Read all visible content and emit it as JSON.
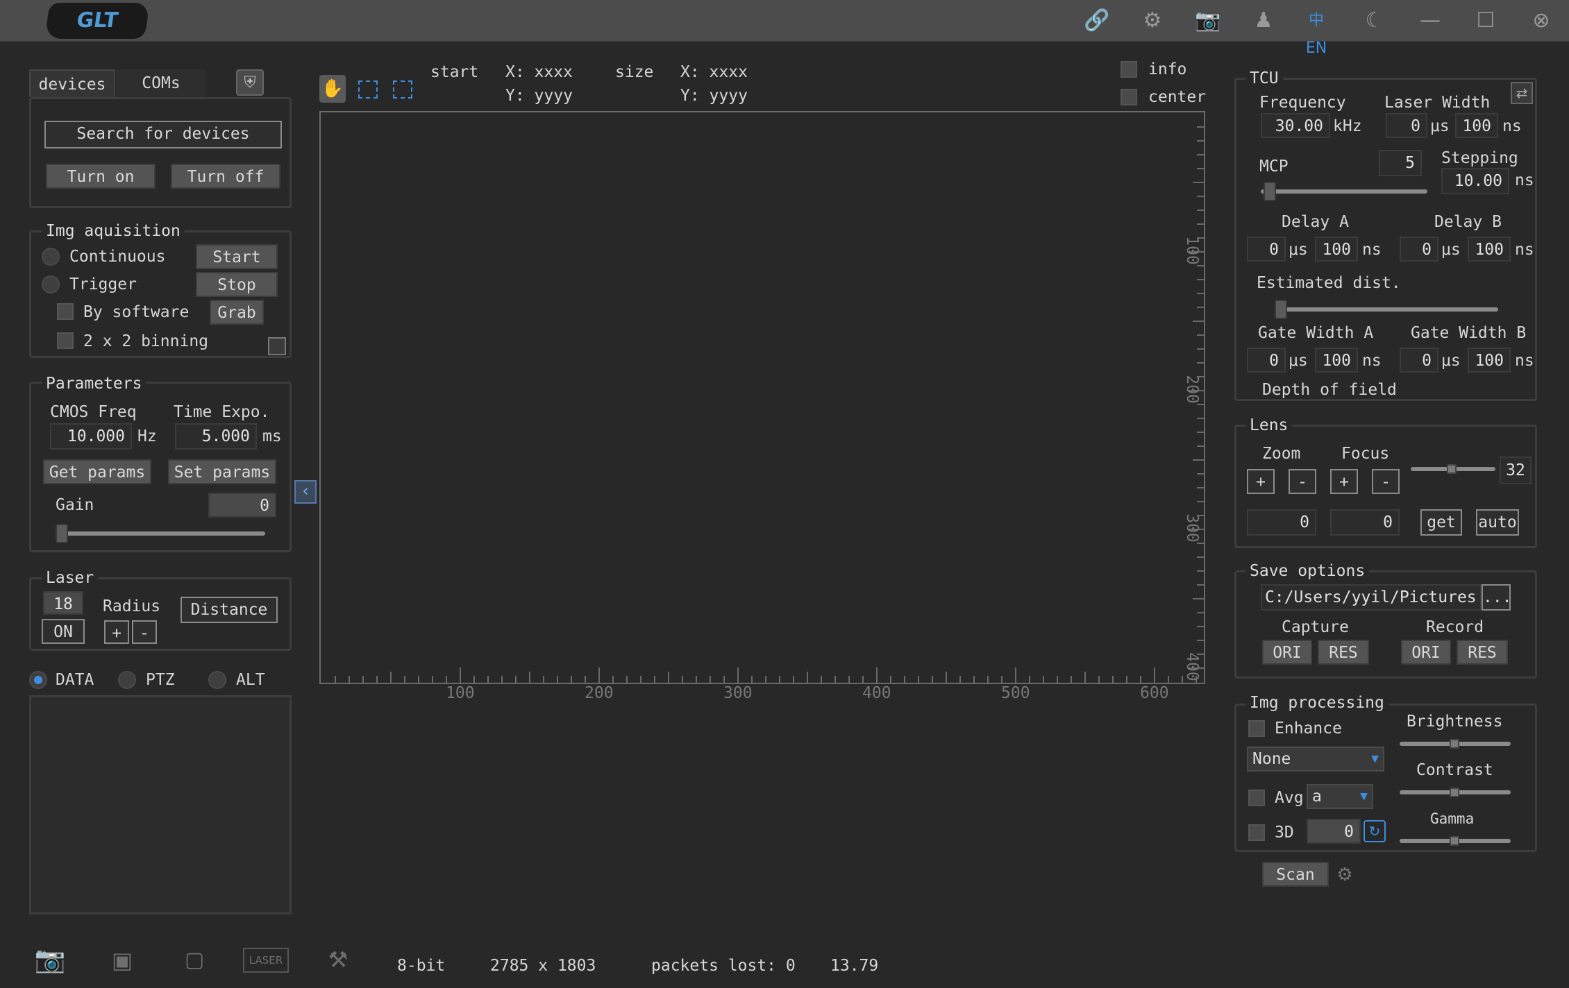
{
  "titlebar": {
    "logo_text": "GLT",
    "icons": [
      "link-icon",
      "gear-icon",
      "camera-icon",
      "user-icon",
      "language-icon",
      "moon-icon",
      "minimize-icon",
      "maximize-icon",
      "close-icon"
    ],
    "language_glyph": "中EN"
  },
  "devices_panel": {
    "tabs": [
      "devices",
      "COMs"
    ],
    "search_label": "Search for devices",
    "turn_on_label": "Turn on",
    "turn_off_label": "Turn off"
  },
  "img_acquisition": {
    "title": "Img aquisition",
    "continuous_label": "Continuous",
    "trigger_label": "Trigger",
    "by_software_label": "By software",
    "binning_label": "2 x 2 binning",
    "start_label": "Start",
    "stop_label": "Stop",
    "grab_label": "Grab"
  },
  "parameters": {
    "title": "Parameters",
    "cmos_freq_label": "CMOS Freq",
    "time_expo_label": "Time Expo.",
    "cmos_freq_value": "10.000",
    "cmos_freq_unit": "Hz",
    "time_expo_value": "5.000",
    "time_expo_unit": "ms",
    "get_params_label": "Get params",
    "set_params_label": "Set params",
    "gain_label": "Gain",
    "gain_value": "0"
  },
  "laser": {
    "title": "Laser",
    "value": "18",
    "radius_label": "Radius",
    "distance_label": "Distance",
    "on_label": "ON",
    "plus_label": "+",
    "minus_label": "-"
  },
  "mode_radios": [
    "DATA",
    "PTZ",
    "ALT"
  ],
  "view_toolbar": {
    "start_label": "start",
    "size_label": "size",
    "start_x": "X: xxxx",
    "start_y": "Y: yyyy",
    "size_x": "X: xxxx",
    "size_y": "Y: yyyy",
    "info_label": "info",
    "center_label": "center"
  },
  "view_axes": {
    "x_ticks": [
      "100",
      "200",
      "300",
      "400",
      "500",
      "600"
    ],
    "y_ticks": [
      "100",
      "200",
      "300",
      "400"
    ]
  },
  "tcu": {
    "title": "TCU",
    "frequency_label": "Frequency",
    "frequency_value": "30.00",
    "frequency_unit": "kHz",
    "laser_width_label": "Laser Width",
    "laser_width_us": "0",
    "laser_width_ns": "100",
    "us_unit": "μs",
    "ns_unit": "ns",
    "mcp_label": "MCP",
    "mcp_value": "5",
    "stepping_label": "Stepping",
    "stepping_value": "10.00",
    "delay_a_label": "Delay A",
    "delay_b_label": "Delay B",
    "delay_a_us": "0",
    "delay_a_ns": "100",
    "delay_b_us": "0",
    "delay_b_ns": "100",
    "est_dist_label": "Estimated dist.",
    "gate_width_a_label": "Gate Width A",
    "gate_width_b_label": "Gate Width B",
    "gate_a_us": "0",
    "gate_a_ns": "100",
    "gate_b_us": "0",
    "gate_b_ns": "100",
    "depth_label": "Depth of field"
  },
  "lens": {
    "title": "Lens",
    "zoom_label": "Zoom",
    "focus_label": "Focus",
    "plus": "+",
    "minus": "-",
    "slider_value": "32",
    "zoom_value": "0",
    "focus_value": "0",
    "get_label": "get",
    "auto_label": "auto"
  },
  "save_options": {
    "title": "Save options",
    "path": "C:/Users/yyil/Pictures",
    "browse_label": "...",
    "capture_label": "Capture",
    "record_label": "Record",
    "ori_label": "ORI",
    "res_label": "RES"
  },
  "img_processing": {
    "title": "Img processing",
    "enhance_label": "Enhance",
    "enhance_select": "None",
    "avg_label": "Avg",
    "avg_select": "a",
    "three_d_label": "3D",
    "three_d_value": "0",
    "brightness_label": "Brightness",
    "contrast_label": "Contrast",
    "gamma_label": "Gamma",
    "scan_label": "Scan"
  },
  "statusbar": {
    "bit_depth": "8-bit",
    "resolution": "2785 x 1803",
    "packets_lost": "packets lost: 0",
    "fps": "13.79",
    "laser_icon_text": "LASER"
  }
}
